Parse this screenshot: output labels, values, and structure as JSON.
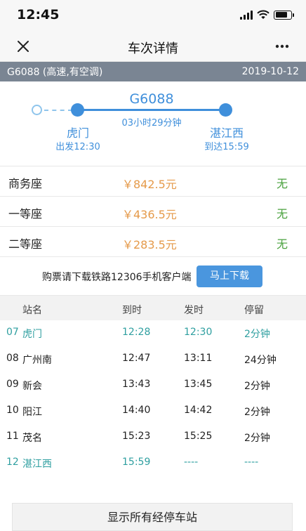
{
  "status": {
    "time": "12:45"
  },
  "nav": {
    "title": "车次详情",
    "close_icon": "close-icon",
    "more_icon": "more-icon"
  },
  "train_info": {
    "label": "G6088 (高速,有空调)",
    "date": "2019-10-12"
  },
  "route": {
    "train_no": "G6088",
    "duration": "03小时29分钟",
    "from": {
      "name": "虎门",
      "time": "出发12:30"
    },
    "to": {
      "name": "湛江西",
      "time": "到达15:59"
    }
  },
  "seats": [
    {
      "name": "商务座",
      "price": "￥842.5元",
      "availability": "无"
    },
    {
      "name": "一等座",
      "price": "￥436.5元",
      "availability": "无"
    },
    {
      "name": "二等座",
      "price": "￥283.5元",
      "availability": "无"
    }
  ],
  "download": {
    "text": "购票请下载铁路12306手机客户端",
    "button": "马上下载"
  },
  "stops_table": {
    "headers": {
      "station": "站名",
      "arrive": "到时",
      "depart": "发时",
      "stay": "停留"
    },
    "rows": [
      {
        "no": "07",
        "station": "虎门",
        "arrive": "12:28",
        "depart": "12:30",
        "stay": "2分钟",
        "highlight": true
      },
      {
        "no": "08",
        "station": "广州南",
        "arrive": "12:47",
        "depart": "13:11",
        "stay": "24分钟",
        "highlight": false
      },
      {
        "no": "09",
        "station": "新会",
        "arrive": "13:43",
        "depart": "13:45",
        "stay": "2分钟",
        "highlight": false
      },
      {
        "no": "10",
        "station": "阳江",
        "arrive": "14:40",
        "depart": "14:42",
        "stay": "2分钟",
        "highlight": false
      },
      {
        "no": "11",
        "station": "茂名",
        "arrive": "15:23",
        "depart": "15:25",
        "stay": "2分钟",
        "highlight": false
      },
      {
        "no": "12",
        "station": "湛江西",
        "arrive": "15:59",
        "depart": "----",
        "stay": "----",
        "highlight": true
      }
    ]
  },
  "show_all_button": "显示所有经停车站",
  "colors": {
    "accent": "#3f8fdb",
    "price": "#e59a4a",
    "available": "#4aa13e",
    "highlight_row": "#2f9fa0",
    "header_bar": "#7a8593"
  }
}
